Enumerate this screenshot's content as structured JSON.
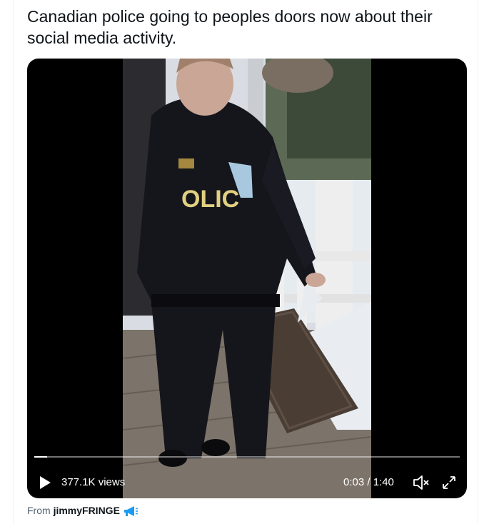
{
  "tweet": {
    "text": "Canadian police going to peoples doors now about their social media activity."
  },
  "video": {
    "vest_text": "OLIC",
    "progress_fraction": 0.03,
    "views": "377.1K views",
    "time": "0:03 / 1:40",
    "play_icon": "play-icon",
    "mute_icon": "muted-speaker-icon",
    "fullscreen_icon": "fullscreen-icon"
  },
  "attribution": {
    "prefix": "From ",
    "user": "jimmyFRINGE",
    "emoji_icon": "megaphone-icon"
  },
  "colors": {
    "text": "#0f1419",
    "secondary": "#536471",
    "video_bg": "#000000",
    "accent_blue": "#1d9bf0"
  }
}
